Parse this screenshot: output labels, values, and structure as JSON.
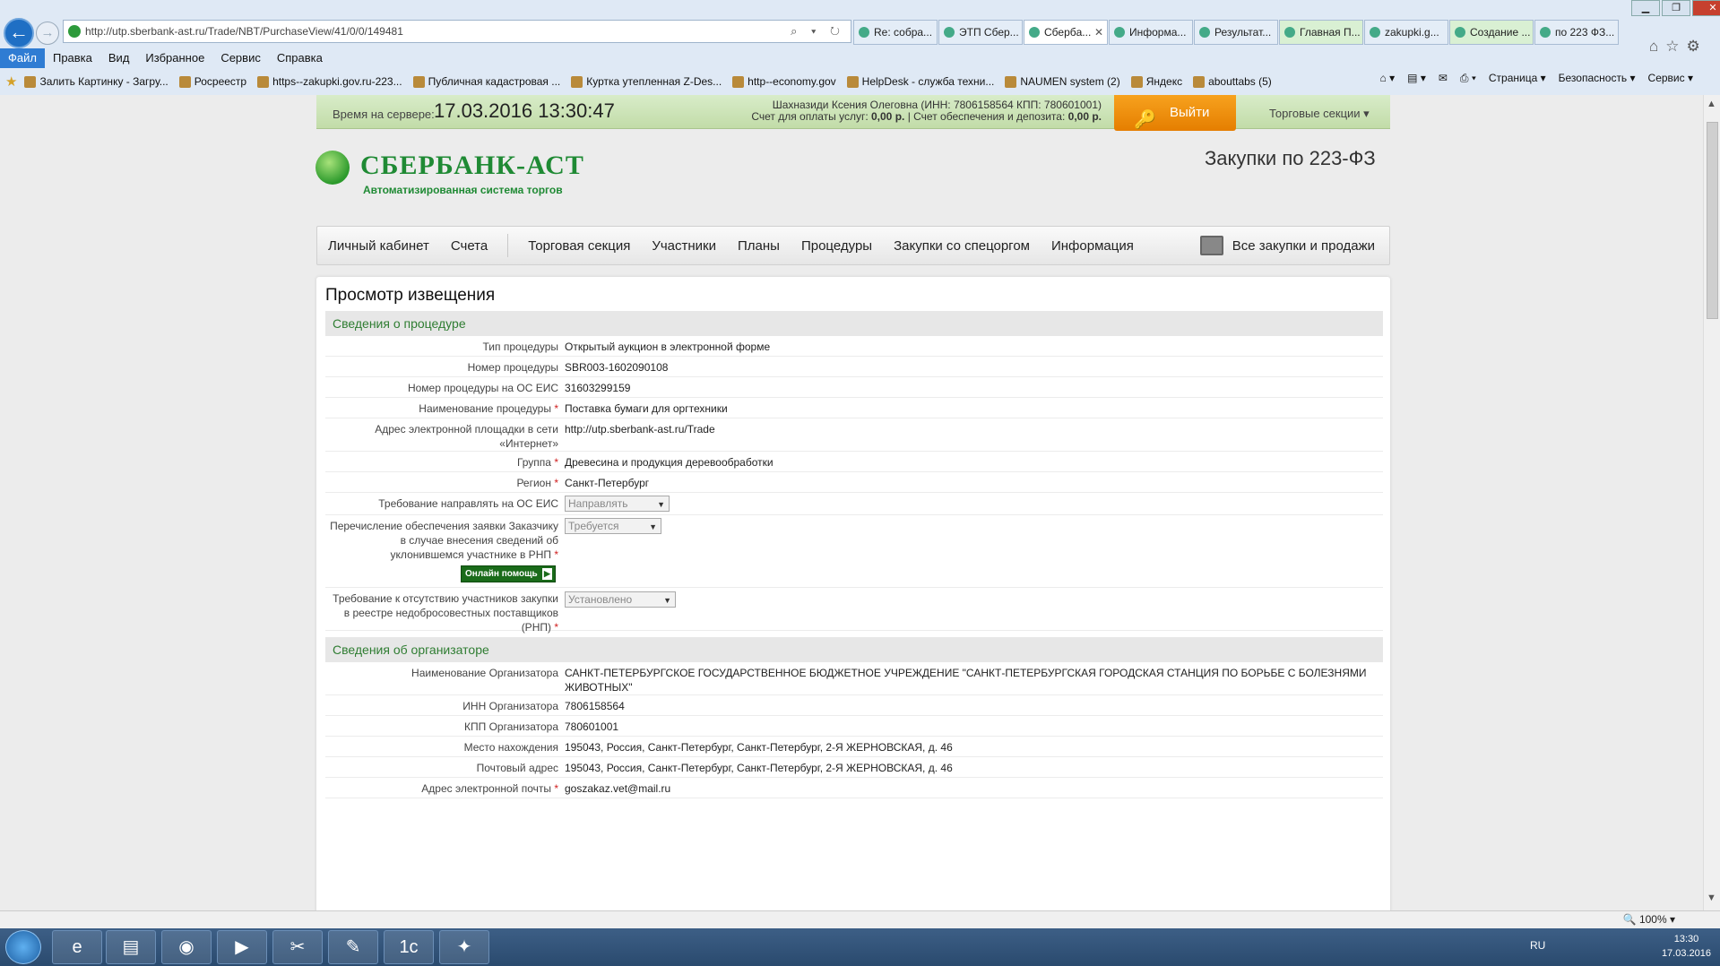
{
  "browser": {
    "url": "http://utp.sberbank-ast.ru/Trade/NBT/PurchaseView/41/0/0/149481",
    "address_tools": "⌕ ▾ ↻",
    "tabs": [
      {
        "label": "Re: собра...",
        "active": false
      },
      {
        "label": "ЭТП Сбер...",
        "active": false
      },
      {
        "label": "Сбербa...",
        "active": true
      },
      {
        "label": "Информа...",
        "active": false
      },
      {
        "label": "Результат...",
        "active": false
      },
      {
        "label": "Главная П...",
        "active": false
      },
      {
        "label": "zakupki.g...",
        "active": false
      },
      {
        "label": "Создание ...",
        "active": false
      },
      {
        "label": "по 223 ФЗ...",
        "active": false
      }
    ],
    "menu": [
      "Файл",
      "Правка",
      "Вид",
      "Избранное",
      "Сервис",
      "Справка"
    ],
    "favorites": [
      "Залить Картинку - Загру...",
      "Росреестр",
      "https--zakupki.gov.ru-223...",
      "Публичная кадастровая ...",
      "Куртка утепленная Z-Des...",
      "http--economy.gov",
      "HelpDesk - служба техни...",
      "NAUMEN system (2)",
      "Яндекс",
      "abouttabs (5)"
    ],
    "command_bar": [
      "Страница ▾",
      "Безопасность ▾",
      "Сервис ▾"
    ],
    "zoom": "100%"
  },
  "header": {
    "server_time_label": "Время на сервере:",
    "server_time": "17.03.2016  13:30:47",
    "user_line1": "Шахназиди Ксения Олеговна (ИНН: 7806158564 КПП: 780601001)",
    "user_line2_prefix": "Счет для оплаты услуг: ",
    "user_line2_services": "0,00 р.",
    "user_line2_mid": " | Счет обеспечения и депозита: ",
    "user_line2_deposit": "0,00 р.",
    "logout_label": "Выйти",
    "trade_sections": "Торговые секции",
    "logo_text": "СБЕРБАНК-АСТ",
    "logo_sub": "Автоматизированная система торгов",
    "page_heading": "Закупки по 223-ФЗ"
  },
  "nav": {
    "left": [
      "Личный кабинет",
      "Счета"
    ],
    "right": [
      "Торговая секция",
      "Участники",
      "Планы",
      "Процедуры",
      "Закупки со спецоргом",
      "Информация"
    ],
    "all_purchases": "Все закупки и продажи"
  },
  "content": {
    "title": "Просмотр извещения",
    "section1": "Сведения о процедуре",
    "section2": "Сведения об организаторе",
    "procedure": {
      "type_label": "Тип процедуры",
      "type_value": "Открытый аукцион в электронной форме",
      "number_label": "Номер процедуры",
      "number_value": "SBR003-1602090108",
      "eis_number_label": "Номер процедуры на ОС ЕИС",
      "eis_number_value": "31603299159",
      "name_label": "Наименование процедуры",
      "name_value": "Поставка бумаги для оргтехники",
      "site_label": "Адрес электронной площадки в сети «Интернет»",
      "site_value": "http://utp.sberbank-ast.ru/Trade",
      "group_label": "Группа",
      "group_value": "Древесина и продукция деревообработки",
      "region_label": "Регион",
      "region_value": "Санкт-Петербург",
      "eis_req_label": "Требование направлять на ОС ЕИС",
      "eis_req_value": "Направлять",
      "transfer_label": "Перечисление обеспечения заявки Заказчику в случае внесения сведений об уклонившемся участнике в РНП",
      "transfer_value": "Требуется",
      "online_help": "Онлайн помощь",
      "rnp_label": "Требование к отсутствию участников закупки в реестре недобросовестных поставщиков (РНП)",
      "rnp_value": "Установлено"
    },
    "organizer": {
      "name_label": "Наименование Организатора",
      "name_value": "САНКТ-ПЕТЕРБУРГСКОЕ ГОСУДАРСТВЕННОЕ БЮДЖЕТНОЕ УЧРЕЖДЕНИЕ \"САНКТ-ПЕТЕРБУРГСКАЯ ГОРОДСКАЯ СТАНЦИЯ ПО БОРЬБЕ С БОЛЕЗНЯМИ ЖИВОТНЫХ\"",
      "inn_label": "ИНН Организатора",
      "inn_value": "7806158564",
      "kpp_label": "КПП Организатора",
      "kpp_value": "780601001",
      "location_label": "Место нахождения",
      "location_value": "195043, Россия, Санкт-Петербург, Санкт-Петербург, 2-Я ЖЕРНОВСКАЯ, д. 46",
      "postal_label": "Почтовый адрес",
      "postal_value": "195043, Россия, Санкт-Петербург, Санкт-Петербург, 2-Я ЖЕРНОВСКАЯ, д. 46",
      "email_label": "Адрес электронной почты",
      "email_value": "goszakaz.vet@mail.ru"
    },
    "required_mark": "*"
  },
  "taskbar": {
    "lang": "RU",
    "time": "13:30",
    "date": "17.03.2016"
  }
}
